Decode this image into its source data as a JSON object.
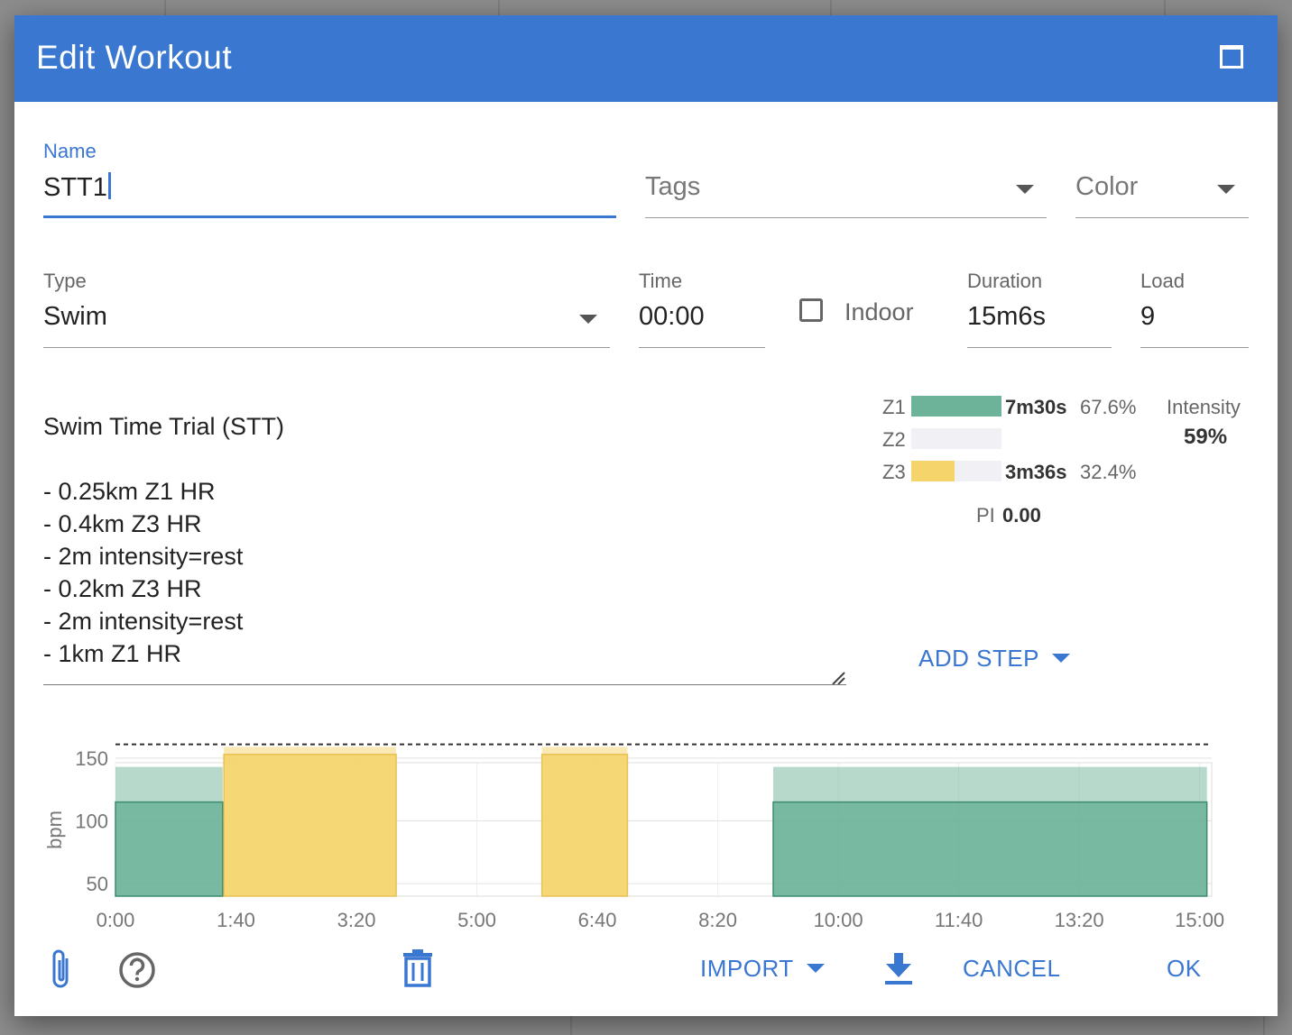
{
  "dialog": {
    "title": "Edit Workout"
  },
  "name": {
    "label": "Name",
    "value": "STT1"
  },
  "tags": {
    "placeholder": "Tags"
  },
  "color": {
    "placeholder": "Color"
  },
  "type": {
    "label": "Type",
    "value": "Swim"
  },
  "time": {
    "label": "Time",
    "value": "00:00"
  },
  "indoor": {
    "label": "Indoor",
    "checked": false
  },
  "duration": {
    "label": "Duration",
    "value": "15m6s"
  },
  "load": {
    "label": "Load",
    "value": "9"
  },
  "description": "Swim Time Trial (STT)\n\n- 0.25km Z1 HR\n- 0.4km Z3 HR\n- 2m intensity=rest\n- 0.2km Z3 HR\n- 2m intensity=rest\n- 1km Z1 HR",
  "zones": [
    {
      "label": "Z1",
      "time": "7m30s",
      "pct": "67.6%",
      "fraction": 1.0,
      "color": "#6db39a"
    },
    {
      "label": "Z2",
      "time": "",
      "pct": "",
      "fraction": 0.0,
      "color": "#6db39a"
    },
    {
      "label": "Z3",
      "time": "3m36s",
      "pct": "32.4%",
      "fraction": 0.48,
      "color": "#f5d46b"
    }
  ],
  "intensity": {
    "label": "Intensity",
    "value": "59%"
  },
  "pi": {
    "label": "PI",
    "value": "0.00"
  },
  "buttons": {
    "add_step": "ADD STEP",
    "import": "IMPORT",
    "cancel": "CANCEL",
    "ok": "OK"
  },
  "icons": {
    "maximize": "maximize-icon",
    "attach": "paperclip-icon",
    "help": "help-circle-icon",
    "delete": "trash-icon",
    "download": "download-icon"
  },
  "colors": {
    "accent": "#3a77d0",
    "z1": "#6db39a",
    "z3": "#f5d46b"
  },
  "chart_data": {
    "type": "bar",
    "ylabel": "bpm",
    "ylim": [
      40,
      160
    ],
    "yticks": [
      50,
      100,
      150
    ],
    "xlim": [
      0,
      910
    ],
    "xticks": [
      "0:00",
      "1:40",
      "3:20",
      "5:00",
      "6:40",
      "8:20",
      "10:00",
      "11:40",
      "13:20",
      "15:00"
    ],
    "xtick_values": [
      0,
      100,
      200,
      300,
      400,
      500,
      600,
      700,
      800,
      900
    ],
    "ceiling_line": 161,
    "steps": [
      {
        "start": 0,
        "end": 89,
        "zone": "Z1",
        "low": 40,
        "high": 115,
        "band_high": 143,
        "color": "#6db39a"
      },
      {
        "start": 90,
        "end": 233,
        "zone": "Z3",
        "low": 40,
        "high": 153,
        "band_high": 159,
        "color": "#f5d46b"
      },
      {
        "start": 354,
        "end": 425,
        "zone": "Z3",
        "low": 40,
        "high": 153,
        "band_high": 159,
        "color": "#f5d46b"
      },
      {
        "start": 546,
        "end": 906,
        "zone": "Z1",
        "low": 40,
        "high": 115,
        "band_high": 143,
        "color": "#6db39a"
      }
    ]
  }
}
